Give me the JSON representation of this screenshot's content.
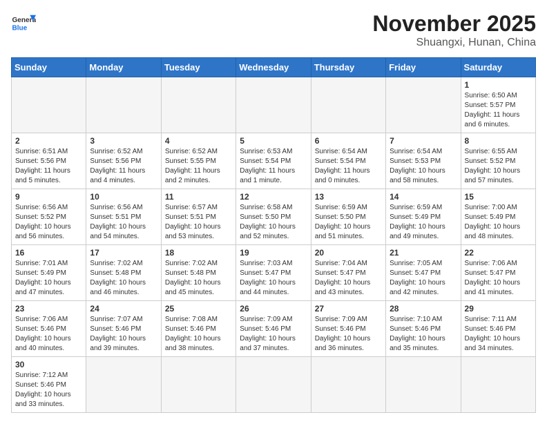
{
  "header": {
    "logo_general": "General",
    "logo_blue": "Blue",
    "month": "November 2025",
    "location": "Shuangxi, Hunan, China"
  },
  "days_of_week": [
    "Sunday",
    "Monday",
    "Tuesday",
    "Wednesday",
    "Thursday",
    "Friday",
    "Saturday"
  ],
  "weeks": [
    [
      {
        "day": "",
        "info": ""
      },
      {
        "day": "",
        "info": ""
      },
      {
        "day": "",
        "info": ""
      },
      {
        "day": "",
        "info": ""
      },
      {
        "day": "",
        "info": ""
      },
      {
        "day": "",
        "info": ""
      },
      {
        "day": "1",
        "info": "Sunrise: 6:50 AM\nSunset: 5:57 PM\nDaylight: 11 hours and 6 minutes."
      }
    ],
    [
      {
        "day": "2",
        "info": "Sunrise: 6:51 AM\nSunset: 5:56 PM\nDaylight: 11 hours and 5 minutes."
      },
      {
        "day": "3",
        "info": "Sunrise: 6:52 AM\nSunset: 5:56 PM\nDaylight: 11 hours and 4 minutes."
      },
      {
        "day": "4",
        "info": "Sunrise: 6:52 AM\nSunset: 5:55 PM\nDaylight: 11 hours and 2 minutes."
      },
      {
        "day": "5",
        "info": "Sunrise: 6:53 AM\nSunset: 5:54 PM\nDaylight: 11 hours and 1 minute."
      },
      {
        "day": "6",
        "info": "Sunrise: 6:54 AM\nSunset: 5:54 PM\nDaylight: 11 hours and 0 minutes."
      },
      {
        "day": "7",
        "info": "Sunrise: 6:54 AM\nSunset: 5:53 PM\nDaylight: 10 hours and 58 minutes."
      },
      {
        "day": "8",
        "info": "Sunrise: 6:55 AM\nSunset: 5:52 PM\nDaylight: 10 hours and 57 minutes."
      }
    ],
    [
      {
        "day": "9",
        "info": "Sunrise: 6:56 AM\nSunset: 5:52 PM\nDaylight: 10 hours and 56 minutes."
      },
      {
        "day": "10",
        "info": "Sunrise: 6:56 AM\nSunset: 5:51 PM\nDaylight: 10 hours and 54 minutes."
      },
      {
        "day": "11",
        "info": "Sunrise: 6:57 AM\nSunset: 5:51 PM\nDaylight: 10 hours and 53 minutes."
      },
      {
        "day": "12",
        "info": "Sunrise: 6:58 AM\nSunset: 5:50 PM\nDaylight: 10 hours and 52 minutes."
      },
      {
        "day": "13",
        "info": "Sunrise: 6:59 AM\nSunset: 5:50 PM\nDaylight: 10 hours and 51 minutes."
      },
      {
        "day": "14",
        "info": "Sunrise: 6:59 AM\nSunset: 5:49 PM\nDaylight: 10 hours and 49 minutes."
      },
      {
        "day": "15",
        "info": "Sunrise: 7:00 AM\nSunset: 5:49 PM\nDaylight: 10 hours and 48 minutes."
      }
    ],
    [
      {
        "day": "16",
        "info": "Sunrise: 7:01 AM\nSunset: 5:49 PM\nDaylight: 10 hours and 47 minutes."
      },
      {
        "day": "17",
        "info": "Sunrise: 7:02 AM\nSunset: 5:48 PM\nDaylight: 10 hours and 46 minutes."
      },
      {
        "day": "18",
        "info": "Sunrise: 7:02 AM\nSunset: 5:48 PM\nDaylight: 10 hours and 45 minutes."
      },
      {
        "day": "19",
        "info": "Sunrise: 7:03 AM\nSunset: 5:47 PM\nDaylight: 10 hours and 44 minutes."
      },
      {
        "day": "20",
        "info": "Sunrise: 7:04 AM\nSunset: 5:47 PM\nDaylight: 10 hours and 43 minutes."
      },
      {
        "day": "21",
        "info": "Sunrise: 7:05 AM\nSunset: 5:47 PM\nDaylight: 10 hours and 42 minutes."
      },
      {
        "day": "22",
        "info": "Sunrise: 7:06 AM\nSunset: 5:47 PM\nDaylight: 10 hours and 41 minutes."
      }
    ],
    [
      {
        "day": "23",
        "info": "Sunrise: 7:06 AM\nSunset: 5:46 PM\nDaylight: 10 hours and 40 minutes."
      },
      {
        "day": "24",
        "info": "Sunrise: 7:07 AM\nSunset: 5:46 PM\nDaylight: 10 hours and 39 minutes."
      },
      {
        "day": "25",
        "info": "Sunrise: 7:08 AM\nSunset: 5:46 PM\nDaylight: 10 hours and 38 minutes."
      },
      {
        "day": "26",
        "info": "Sunrise: 7:09 AM\nSunset: 5:46 PM\nDaylight: 10 hours and 37 minutes."
      },
      {
        "day": "27",
        "info": "Sunrise: 7:09 AM\nSunset: 5:46 PM\nDaylight: 10 hours and 36 minutes."
      },
      {
        "day": "28",
        "info": "Sunrise: 7:10 AM\nSunset: 5:46 PM\nDaylight: 10 hours and 35 minutes."
      },
      {
        "day": "29",
        "info": "Sunrise: 7:11 AM\nSunset: 5:46 PM\nDaylight: 10 hours and 34 minutes."
      }
    ],
    [
      {
        "day": "30",
        "info": "Sunrise: 7:12 AM\nSunset: 5:46 PM\nDaylight: 10 hours and 33 minutes."
      },
      {
        "day": "",
        "info": ""
      },
      {
        "day": "",
        "info": ""
      },
      {
        "day": "",
        "info": ""
      },
      {
        "day": "",
        "info": ""
      },
      {
        "day": "",
        "info": ""
      },
      {
        "day": "",
        "info": ""
      }
    ]
  ]
}
